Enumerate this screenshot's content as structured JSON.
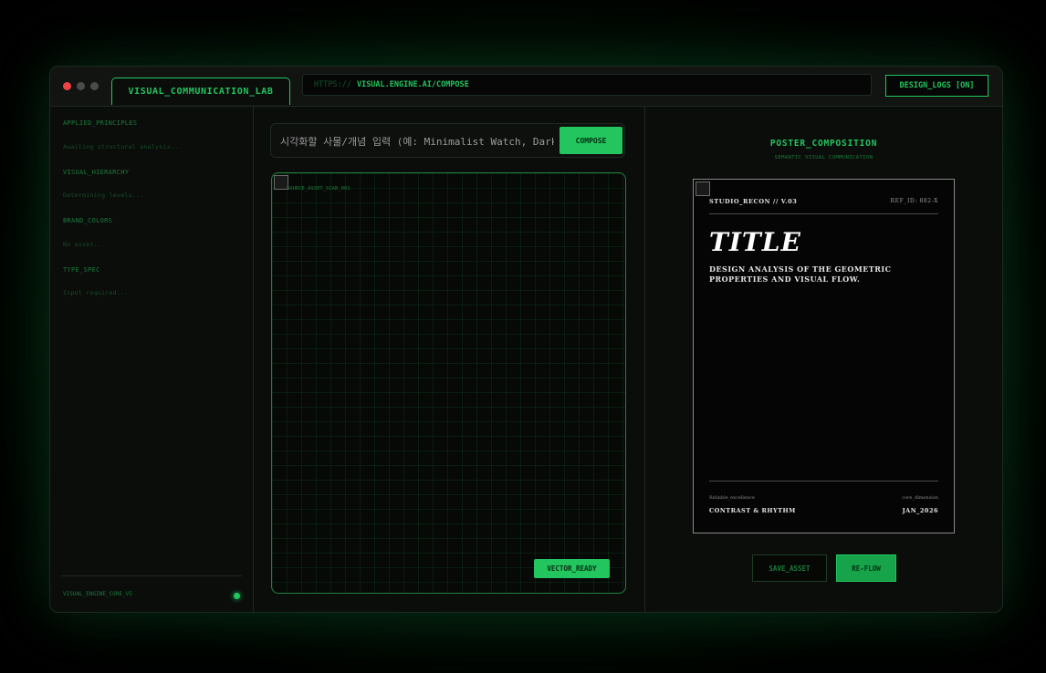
{
  "window": {
    "tab_label": "VISUAL_COMMUNICATION_LAB",
    "url_protocol": "HTTPS://",
    "url_path": "VISUAL.ENGINE.AI/COMPOSE",
    "logs_button": "DESIGN_LOGS [ON]"
  },
  "sidebar": {
    "sections": [
      {
        "label": "APPLIED_PRINCIPLES",
        "status": "Awaiting structural analysis..."
      },
      {
        "label": "VISUAL_HIERARCHY",
        "status": "Determining levels..."
      },
      {
        "label": "BRAND_COLORS",
        "status": "No asset..."
      },
      {
        "label": "TYPE_SPEC",
        "status": "Input required..."
      }
    ],
    "footer": "VISUAL_ENGINE_CORE_V5"
  },
  "compose": {
    "input_placeholder": "시각화할 사물/개념 입력 (예: Minimalist Watch, Dark Roast Coffee)",
    "compose_button": "COMPOSE",
    "canvas_caption": "SOURCE_ASSET_SCAN_001",
    "status_button": "VECTOR_READY"
  },
  "poster_panel": {
    "title": "POSTER_COMPOSITION",
    "subtitle": "SEMANTIC VISUAL COMMUNICATION",
    "poster": {
      "studio": "STUDIO_RECON // V.03",
      "ref_id": "REF_ID: 882-X",
      "headline": "TITLE",
      "description": "DESIGN ANALYSIS OF THE GEOMETRIC PROPERTIES AND VISUAL FLOW.",
      "footer_left_caption": "Reliable_excellence",
      "footer_right_caption": "core_dimension",
      "footer_left": "CONTRAST & RHYTHM",
      "footer_right": "JAN_2026"
    },
    "save_button": "SAVE_ASSET",
    "reflow_button": "RE-FLOW"
  },
  "colors": {
    "accent": "#22c55e",
    "background": "#0b0d0b",
    "close_dot": "#ef4444"
  }
}
